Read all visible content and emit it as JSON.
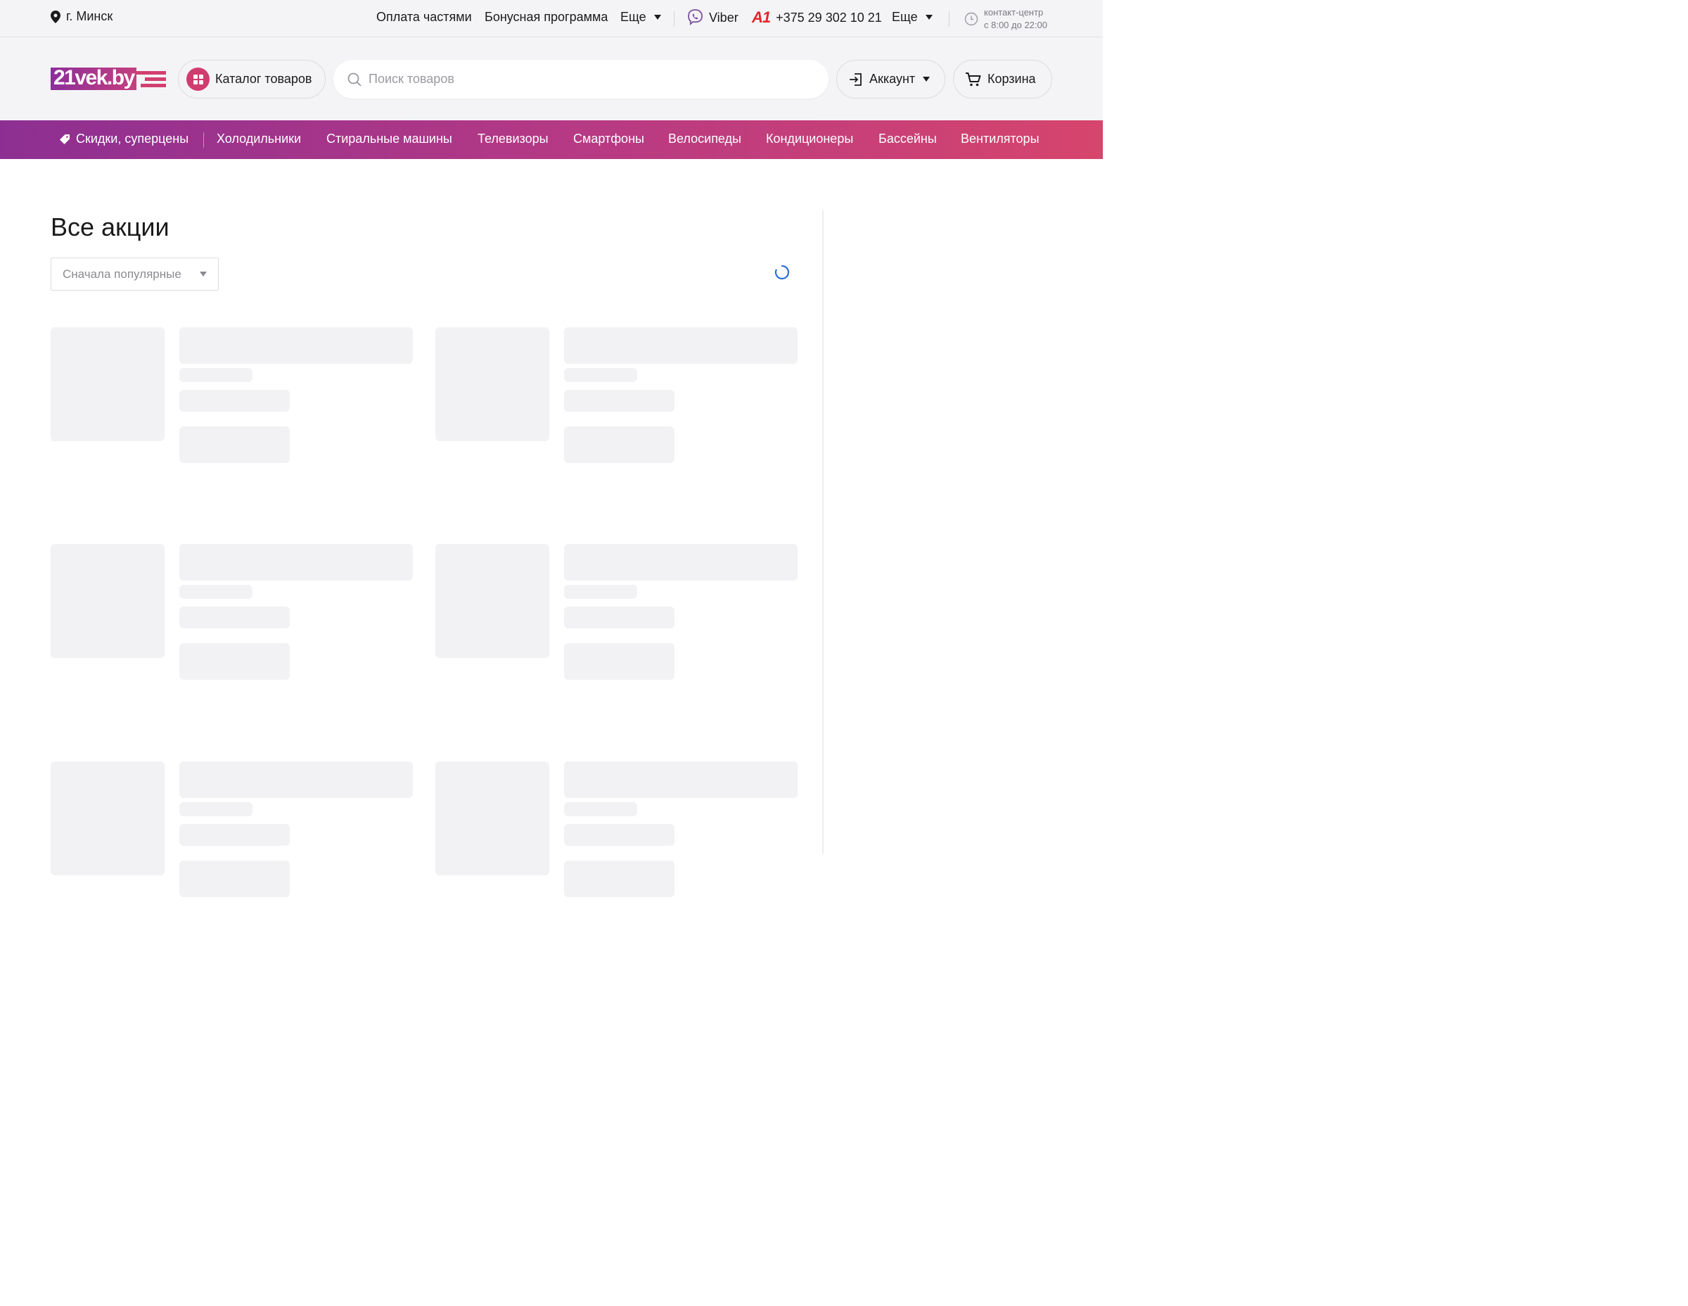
{
  "topbar": {
    "city": "г. Минск",
    "links": [
      "Оплата частями",
      "Бонусная программа"
    ],
    "more_label": "Еще",
    "viber_label": "Viber",
    "operator_label": "A1",
    "phone": "+375 29 302 10 21",
    "more2_label": "Еще",
    "hours_title": "контакт-центр",
    "hours_time": "с 8:00 до 22:00"
  },
  "header": {
    "logo_text": "21vek.by",
    "catalog_label": "Каталог товаров",
    "search_placeholder": "Поиск товаров",
    "account_label": "Аккаунт",
    "cart_label": "Корзина"
  },
  "nav": {
    "items": [
      "Скидки, суперцены",
      "Холодильники",
      "Стиральные машины",
      "Телевизоры",
      "Смартфоны",
      "Велосипеды",
      "Кондиционеры",
      "Бассейны",
      "Вентиляторы"
    ]
  },
  "main": {
    "title": "Все акции",
    "sort_selected": "Сначала популярные",
    "loading": true
  },
  "colors": {
    "accent": "#d03c6e",
    "nav_start": "#8d2f92",
    "nav_end": "#d6456c",
    "skeleton": "#f2f2f4",
    "spinner": "#2f6fd1"
  }
}
